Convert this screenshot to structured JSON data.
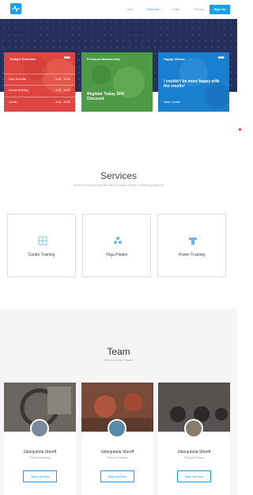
{
  "nav": {
    "links": [
      "Intro",
      "Services",
      "Team",
      "Pricing"
    ],
    "active_index": 1,
    "signup_label": "Sign Up",
    "accent": "#18a0e8"
  },
  "cards": {
    "schedule": {
      "title": "Today's Schedule",
      "rows": [
        {
          "name": "Early Exercise",
          "time": "8:30 - 10:00"
        },
        {
          "name": "Muscle Building",
          "time": "8:30 - 10:00"
        },
        {
          "name": "Cardio",
          "time": "8:30 - 10:00"
        }
      ],
      "color": "#e04641"
    },
    "membership": {
      "title": "Premium Membership",
      "headline": "Register Today 20% Discount",
      "color": "#4e9b46"
    },
    "client": {
      "title": "Happy Clients",
      "quote": "I couldn't be more happy with the results!",
      "author": "Adam Jordan",
      "color": "#1b7fd0"
    }
  },
  "services": {
    "title": "Services",
    "subtitle": "Achieve the best results with our wide variety of training options!",
    "items": [
      {
        "label": "Cardio Training",
        "icon": "cardio-icon"
      },
      {
        "label": "Yoga Pilates",
        "icon": "yoga-icon"
      },
      {
        "label": "Power Training",
        "icon": "power-icon"
      }
    ]
  },
  "team": {
    "title": "Team",
    "subtitle": "We're a dream team!",
    "members": [
      {
        "name": "Gbonjubola Sheriff",
        "role": "Fitness Instructor",
        "button": "Sign Up Now"
      },
      {
        "name": "Gbonjubola Sheriff",
        "role": "Personal Trainer",
        "button": "Sign Up Now"
      },
      {
        "name": "Gbonjubola Sheriff",
        "role": "Personal Trainer",
        "button": "Sign Up Now"
      }
    ]
  }
}
